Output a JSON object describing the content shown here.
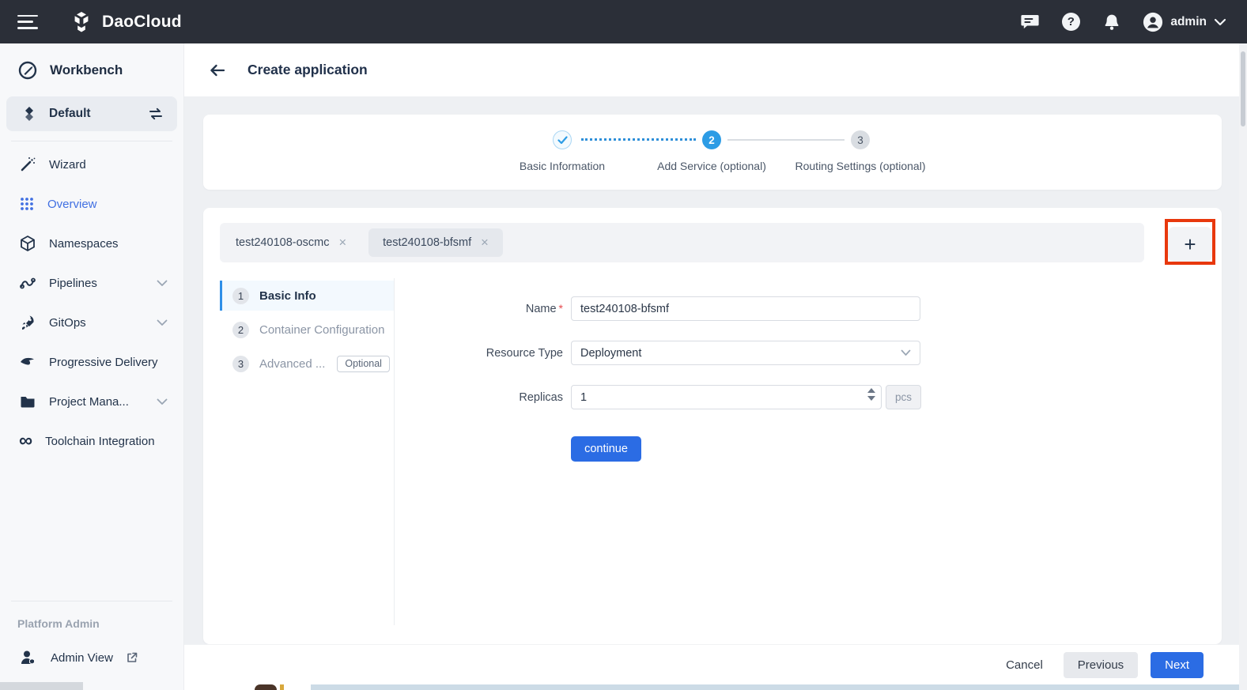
{
  "topbar": {
    "brand": "DaoCloud",
    "user": "admin"
  },
  "sidebar": {
    "section_title": "Workbench",
    "workspace": {
      "label": "Default"
    },
    "items": [
      {
        "label": "Wizard"
      },
      {
        "label": "Overview",
        "active": true
      },
      {
        "label": "Namespaces"
      },
      {
        "label": "Pipelines",
        "chevron": true
      },
      {
        "label": "GitOps",
        "chevron": true
      },
      {
        "label": "Progressive Delivery"
      },
      {
        "label": "Project Mana...",
        "chevron": true
      },
      {
        "label": "Toolchain Integration"
      }
    ],
    "footer_section": "Platform Admin",
    "admin_view": "Admin View"
  },
  "header": {
    "title": "Create application"
  },
  "stepper": {
    "steps": [
      {
        "num": "1",
        "label": "Basic Information",
        "state": "done"
      },
      {
        "num": "2",
        "label": "Add Service (optional)",
        "state": "active"
      },
      {
        "num": "3",
        "label": "Routing Settings (optional)",
        "state": "pending"
      }
    ]
  },
  "tabs": {
    "items": [
      {
        "label": "test240108-oscmc"
      },
      {
        "label": "test240108-bfsmf",
        "active": true
      }
    ]
  },
  "wizard_nav": {
    "items": [
      {
        "num": "1",
        "label": "Basic Info",
        "active": true
      },
      {
        "num": "2",
        "label": "Container Configuration"
      },
      {
        "num": "3",
        "label": "Advanced ...",
        "badge": "Optional"
      }
    ]
  },
  "form": {
    "fields": {
      "name": {
        "label": "Name",
        "required": true,
        "value": "test240108-bfsmf"
      },
      "resource_type": {
        "label": "Resource Type",
        "value": "Deployment"
      },
      "replicas": {
        "label": "Replicas",
        "value": "1",
        "unit": "pcs"
      }
    },
    "continue_label": "continue"
  },
  "footer": {
    "cancel": "Cancel",
    "previous": "Previous",
    "next": "Next"
  },
  "icons": {
    "plus": "+",
    "close": "×",
    "question": "?",
    "infinity": "∞",
    "asterisk": "*"
  },
  "colors": {
    "topbar_bg": "#2b2f38",
    "accent_blue": "#2b6ce4",
    "stepper_blue": "#2d9ce5",
    "sidebar_active_text": "#4170e2",
    "annotation_red": "#e8380d",
    "page_bg": "#eef0f3"
  }
}
